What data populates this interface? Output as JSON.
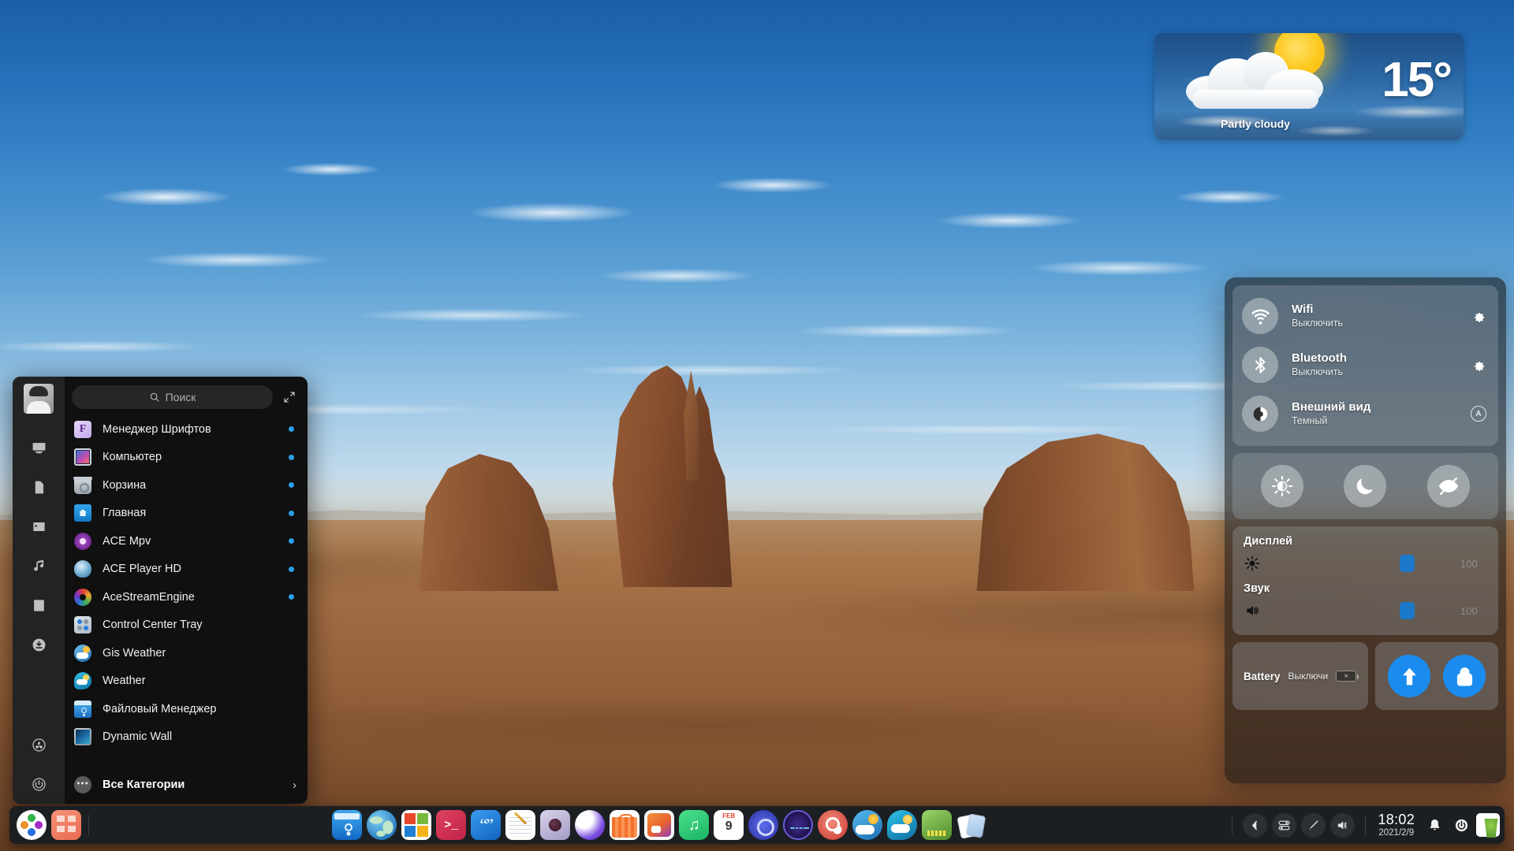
{
  "weather_widget": {
    "temperature": "15°",
    "condition": "Partly cloudy"
  },
  "start_menu": {
    "search": {
      "placeholder": "Поиск",
      "value": ""
    },
    "expand_label": "expand",
    "sidebar": [
      {
        "name": "computer",
        "icon": "monitor-icon"
      },
      {
        "name": "documents",
        "icon": "document-icon"
      },
      {
        "name": "pictures",
        "icon": "image-icon"
      },
      {
        "name": "music",
        "icon": "music-note-icon"
      },
      {
        "name": "videos",
        "icon": "film-icon"
      },
      {
        "name": "downloads",
        "icon": "download-icon"
      },
      {
        "name": "settings",
        "icon": "settings-gear-icon"
      },
      {
        "name": "power",
        "icon": "power-icon"
      }
    ],
    "apps": [
      {
        "label": "Менеджер Шрифтов",
        "icon": "font-manager-icon",
        "dot": true
      },
      {
        "label": "Компьютер",
        "icon": "computer-icon",
        "dot": true
      },
      {
        "label": "Корзина",
        "icon": "trash-icon",
        "dot": true
      },
      {
        "label": "Главная",
        "icon": "home-folder-icon",
        "dot": true
      },
      {
        "label": "ACE Mpv",
        "icon": "mpv-icon",
        "dot": true
      },
      {
        "label": "ACE Player HD",
        "icon": "ace-player-icon",
        "dot": true
      },
      {
        "label": "AceStreamEngine",
        "icon": "acestream-icon",
        "dot": true
      },
      {
        "label": "Control Center Tray",
        "icon": "control-center-tray-icon",
        "dot": false
      },
      {
        "label": "Gis Weather",
        "icon": "gis-weather-icon",
        "dot": false
      },
      {
        "label": "Weather",
        "icon": "weather-icon",
        "dot": false
      },
      {
        "label": "Файловый Менеджер",
        "icon": "file-manager-icon",
        "dot": false
      },
      {
        "label": "Dynamic Wall",
        "icon": "dynamic-wall-icon",
        "dot": false
      }
    ],
    "all_categories": {
      "label": "Все Категории",
      "arrow": "›"
    }
  },
  "control_center": {
    "toggles": [
      {
        "title": "Wifi",
        "subtitle": "Выключить",
        "icon": "wifi-icon",
        "action": "gear-icon"
      },
      {
        "title": "Bluetooth",
        "subtitle": "Выключить",
        "icon": "bluetooth-icon",
        "action": "gear-icon"
      },
      {
        "title": "Внешний вид",
        "subtitle": "Темный",
        "icon": "appearance-icon",
        "action": "auto-badge",
        "action_label": "A"
      }
    ],
    "modes": [
      {
        "name": "night-light-mode",
        "icon": "sun-moon-icon"
      },
      {
        "name": "do-not-disturb-mode",
        "icon": "moon-icon"
      },
      {
        "name": "privacy-mode",
        "icon": "eye-slash-icon"
      }
    ],
    "sliders": [
      {
        "label": "Дисплей",
        "icon": "brightness-icon",
        "value": "100"
      },
      {
        "label": "Звук",
        "icon": "volume-icon",
        "value": "100"
      }
    ],
    "battery": {
      "label": "Battery",
      "state": "Выключи",
      "glyph": "×"
    },
    "actions": [
      {
        "name": "upload-button",
        "icon": "arrow-up-icon"
      },
      {
        "name": "lock-button",
        "icon": "lock-icon"
      }
    ]
  },
  "taskbar": {
    "left_icons": [
      {
        "name": "app-launcher",
        "art": "tbi-launcher"
      },
      {
        "name": "show-applications",
        "art": "tbi-showapps"
      }
    ],
    "pinned_icons": [
      {
        "name": "file-manager",
        "art": "tbi-files"
      },
      {
        "name": "web-browser",
        "art": "tbi-browser"
      },
      {
        "name": "office-suite",
        "art": "tbi-office"
      },
      {
        "name": "terminal",
        "art": "tbi-terminal"
      },
      {
        "name": "notes-app",
        "art": "tbi-notes"
      },
      {
        "name": "text-editor",
        "art": "tbi-editor"
      },
      {
        "name": "camera-app",
        "art": "tbi-camera"
      },
      {
        "name": "wave-app",
        "art": "tbi-wave"
      },
      {
        "name": "app-store",
        "art": "tbi-store"
      },
      {
        "name": "software-center",
        "art": "tbi-store2"
      },
      {
        "name": "music-player",
        "art": "tbi-music"
      },
      {
        "name": "calendar",
        "art": "tbi-cal"
      },
      {
        "name": "system-settings",
        "art": "tbi-settings"
      },
      {
        "name": "system-monitor",
        "art": "tbi-monitor"
      },
      {
        "name": "search-app",
        "art": "tbi-search"
      },
      {
        "name": "gis-weather",
        "art": "tbi-gisw"
      },
      {
        "name": "weather-app",
        "art": "tbi-weather2"
      },
      {
        "name": "money-manager",
        "art": "tbi-money"
      },
      {
        "name": "solitaire",
        "art": "tbi-cards"
      }
    ],
    "tray": [
      {
        "name": "tray-expand",
        "icon": "chevron-left-icon"
      },
      {
        "name": "tray-toggles",
        "icon": "sliders-icon"
      },
      {
        "name": "tray-pen",
        "icon": "pen-icon"
      },
      {
        "name": "tray-volume",
        "icon": "volume-icon"
      }
    ],
    "clock": {
      "time": "18:02",
      "date": "2021/2/9"
    },
    "right_icons": [
      {
        "name": "notifications",
        "icon": "bell-icon"
      },
      {
        "name": "power-menu",
        "icon": "power-icon"
      },
      {
        "name": "tea-timer",
        "icon": "tea-cup-icon"
      }
    ]
  },
  "colors": {
    "accent_blue": "#1a8cf0",
    "slider_blue": "#1c78c8",
    "dot_blue": "#2b9fe6",
    "taskbar_bg": "#1c1f22",
    "menu_bg": "#101010"
  }
}
